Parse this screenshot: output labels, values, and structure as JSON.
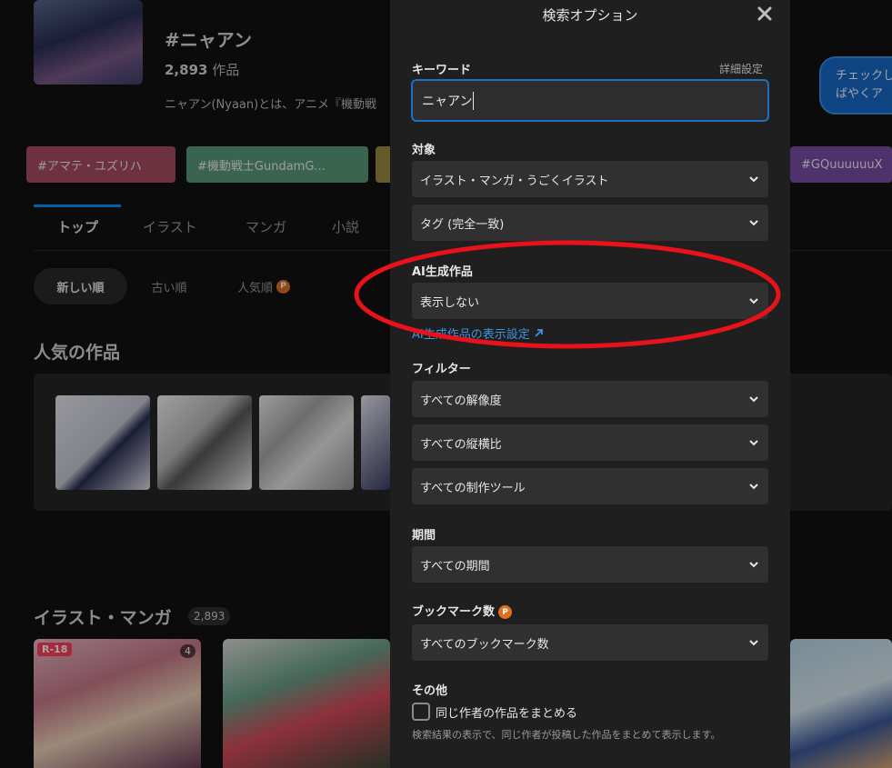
{
  "tag": {
    "title": "#ニャアン",
    "count": "2,893",
    "count_suffix": " 作品",
    "description": "ニャアン(Nyaan)とは、アニメ『機動戦"
  },
  "chips": [
    "#アマテ・ユズリハ",
    "#機動戦士GundamG...",
    "",
    "#GQuuuuuuX"
  ],
  "chip_colors": [
    "#a84c63",
    "#5a9a7a",
    "#9a8a40",
    "#7a4ea6"
  ],
  "tabs": [
    "トップ",
    "イラスト",
    "マンガ",
    "小説"
  ],
  "sort": {
    "new": "新しい順",
    "old": "古い順",
    "popular": "人気順",
    "p_badge": "P"
  },
  "popular_title": "人気の作品",
  "illust_title": "イラスト・マンガ",
  "illust_count": "2,893",
  "work_badges": {
    "r18": "R-18",
    "pages": "4"
  },
  "tooltip": {
    "line1": "チェックし",
    "line2": "ばやくア"
  },
  "modal": {
    "title": "検索オプション",
    "keyword_label": "キーワード",
    "advanced_label": "詳細設定",
    "keyword_value": "ニャアン",
    "target_label": "対象",
    "target_type": "イラスト・マンガ・うごくイラスト",
    "target_match": "タグ (完全一致)",
    "ai_label": "AI生成作品",
    "ai_value": "表示しない",
    "ai_link": "AI生成作品の表示設定",
    "filter_label": "フィルター",
    "resolution": "すべての解像度",
    "aspect": "すべての縦横比",
    "tool": "すべての制作ツール",
    "period_label": "期間",
    "period": "すべての期間",
    "bookmark_label": "ブックマーク数",
    "bookmark": "すべてのブックマーク数",
    "other_label": "その他",
    "group_label": "同じ作者の作品をまとめる",
    "group_help": "検索結果の表示で、同じ作者が投稿した作品をまとめて表示します。"
  },
  "colors": {
    "accent": "#0096fa",
    "annotation": "#e8121b",
    "link": "#3d95e4"
  }
}
